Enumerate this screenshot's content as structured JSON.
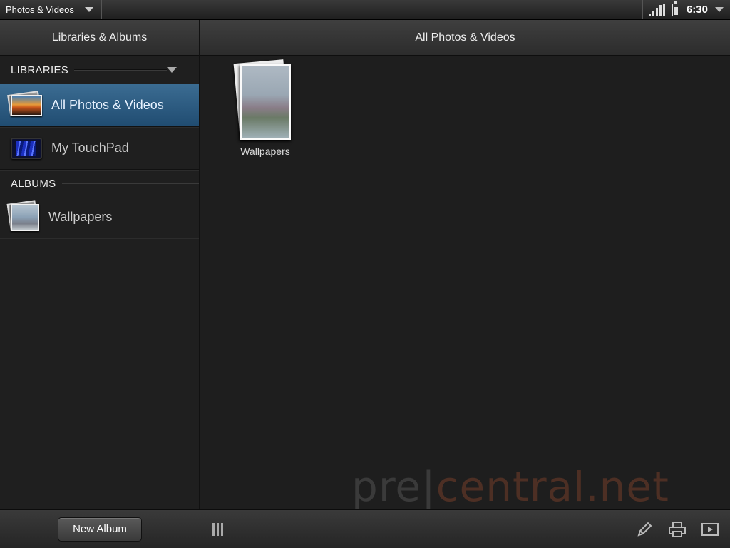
{
  "statusbar": {
    "app_title": "Photos & Videos",
    "time": "6:30"
  },
  "left": {
    "header": "Libraries & Albums",
    "libraries_label": "LIBRARIES",
    "libraries": [
      {
        "label": "All Photos & Videos",
        "selected": true
      },
      {
        "label": "My TouchPad",
        "selected": false
      }
    ],
    "albums_label": "ALBUMS",
    "albums": [
      {
        "label": "Wallpapers"
      }
    ],
    "new_album": "New Album"
  },
  "main": {
    "header": "All Photos & Videos",
    "grid": [
      {
        "caption": "Wallpapers"
      }
    ]
  },
  "watermark": {
    "part1": "pre",
    "sep": "|",
    "part2": "central.net"
  },
  "colors": {
    "selected": "#2e5c84",
    "background": "#1e1e1e"
  },
  "icons": [
    "signal-icon",
    "battery-icon",
    "edit-icon",
    "print-icon",
    "slideshow-icon",
    "grip-icon"
  ]
}
